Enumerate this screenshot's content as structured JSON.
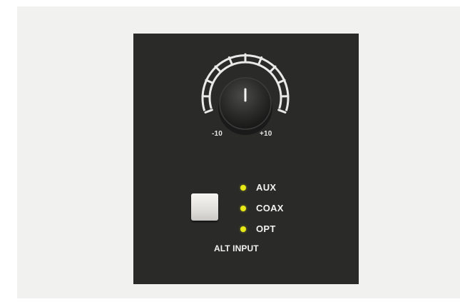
{
  "colors": {
    "background": "#f1f1f0",
    "panel": "#2a2a29",
    "led": "#e8ea17",
    "label": "#f2f2f2",
    "button_face": "#e6e5e1"
  },
  "knob": {
    "icon": "rotary-knob-icon",
    "scale_min_label": "-10",
    "scale_max_label": "+10",
    "tick_count": 11
  },
  "inputs": {
    "items": [
      {
        "label": "AUX",
        "led_on": true
      },
      {
        "label": "COAX",
        "led_on": true
      },
      {
        "label": "OPT",
        "led_on": true
      }
    ]
  },
  "alt_input": {
    "caption": "ALT INPUT"
  }
}
